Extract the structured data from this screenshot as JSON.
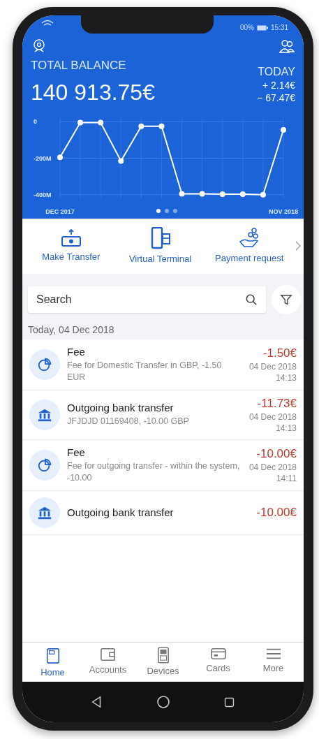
{
  "status_bar": {
    "battery": "00%",
    "time": "15:31"
  },
  "balance": {
    "label": "TOTAL BALANCE",
    "amount": "140 913.75€",
    "today_label": "TODAY",
    "today_in": "+ 2.14€",
    "today_out": "− 67.47€"
  },
  "chart_data": {
    "type": "line",
    "grid": true,
    "ylim": [
      -420,
      20
    ],
    "yticks": [
      {
        "value": 0,
        "label": "0"
      },
      {
        "value": -200,
        "label": "-200M"
      },
      {
        "value": -400,
        "label": "-400M"
      }
    ],
    "categories": [
      "DEC 2017",
      null,
      null,
      null,
      null,
      null,
      null,
      null,
      null,
      null,
      null,
      "NOV 2018"
    ],
    "series": [
      {
        "color": "#ffffff",
        "marker": "circle",
        "values": [
          -195,
          -5,
          -5,
          -215,
          -25,
          -25,
          -395,
          -395,
          -397,
          -397,
          -400,
          -45
        ]
      }
    ]
  },
  "pages": [
    {
      "selected": true
    },
    {
      "selected": false
    },
    {
      "selected": false
    }
  ],
  "actions": [
    {
      "kind": "transfer",
      "label": "Make Transfer"
    },
    {
      "kind": "terminal",
      "label": "Virtual Terminal"
    },
    {
      "kind": "request",
      "label": "Payment request"
    }
  ],
  "search": {
    "placeholder": "Search"
  },
  "date_header": "Today, 04 Dec 2018",
  "transactions": [
    {
      "kind": "fee",
      "title": "Fee",
      "description": "Fee for Domestic Transfer in GBP, -1.50 EUR",
      "amount": "-1.50€",
      "date": "04 Dec 2018",
      "time": "14:13"
    },
    {
      "kind": "bank",
      "title": "Outgoing bank transfer",
      "description": "JFJDJD 01169408, -10.00 GBP",
      "amount": "-11.73€",
      "date": "04 Dec 2018",
      "time": "14:13"
    },
    {
      "kind": "fee",
      "title": "Fee",
      "description": "Fee for outgoing transfer - within the system, -10.00",
      "amount": "-10.00€",
      "date": "04 Dec 2018",
      "time": "14:11"
    },
    {
      "kind": "bank",
      "title": "Outgoing bank transfer",
      "amount": "-10.00€"
    }
  ],
  "nav": [
    {
      "kind": "home",
      "label": "Home",
      "selected": true
    },
    {
      "kind": "accounts",
      "label": "Accounts",
      "selected": false
    },
    {
      "kind": "devices",
      "label": "Devices",
      "selected": false
    },
    {
      "kind": "cards",
      "label": "Cards",
      "selected": false
    },
    {
      "kind": "more",
      "label": "More",
      "selected": false
    }
  ]
}
